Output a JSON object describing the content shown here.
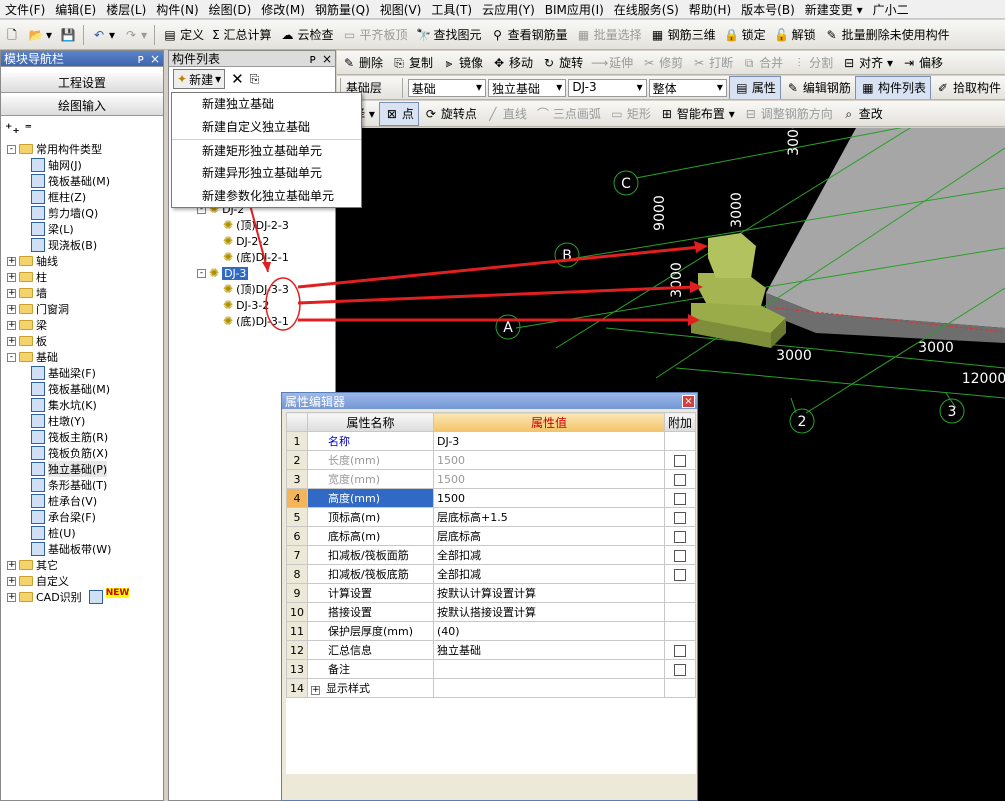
{
  "menu": [
    "文件(F)",
    "编辑(E)",
    "楼层(L)",
    "构件(N)",
    "绘图(D)",
    "修改(M)",
    "钢筋量(Q)",
    "视图(V)",
    "工具(T)",
    "云应用(Y)",
    "BIM应用(I)",
    "在线服务(S)",
    "帮助(H)",
    "版本号(B)",
    "新建变更 ▾",
    "广小二"
  ],
  "toolbar1": [
    "定义",
    "Σ 汇总计算",
    "云检查",
    "平齐板顶",
    "查找图元",
    "查看钢筋量",
    "批量选择",
    "钢筋三维",
    "锁定",
    "解锁",
    "批量删除未使用构件"
  ],
  "toolbar2": [
    "删除",
    "复制",
    "镜像",
    "移动",
    "旋转",
    "延伸",
    "修剪",
    "打断",
    "合并",
    "分割",
    "对齐 ▾",
    "偏移"
  ],
  "toolbar3": {
    "floor_label": "基础层",
    "floor": "基础",
    "type": "独立基础",
    "component": "DJ-3",
    "unit": "整体",
    "buttons": [
      "属性",
      "编辑钢筋",
      "构件列表",
      "拾取构件"
    ]
  },
  "toolbar4": [
    "选择 ▾",
    "点",
    "旋转点",
    "直线",
    "三点画弧",
    "矩形",
    "智能布置 ▾",
    "调整钢筋方向",
    "查改"
  ],
  "nav": {
    "title": "模块导航栏",
    "pin": "ᴘ",
    "close": "×",
    "btn1": "工程设置",
    "btn2": "绘图输入",
    "tree": [
      {
        "t": "常用构件类型",
        "lvl": 0,
        "pm": "-",
        "kind": "folder"
      },
      {
        "t": "轴网(J)",
        "lvl": 1,
        "kind": "comp"
      },
      {
        "t": "筏板基础(M)",
        "lvl": 1,
        "kind": "comp"
      },
      {
        "t": "框柱(Z)",
        "lvl": 1,
        "kind": "comp"
      },
      {
        "t": "剪力墙(Q)",
        "lvl": 1,
        "kind": "comp"
      },
      {
        "t": "梁(L)",
        "lvl": 1,
        "kind": "comp"
      },
      {
        "t": "现浇板(B)",
        "lvl": 1,
        "kind": "comp"
      },
      {
        "t": "轴线",
        "lvl": 0,
        "pm": "+",
        "kind": "folder"
      },
      {
        "t": "柱",
        "lvl": 0,
        "pm": "+",
        "kind": "folder"
      },
      {
        "t": "墙",
        "lvl": 0,
        "pm": "+",
        "kind": "folder"
      },
      {
        "t": "门窗洞",
        "lvl": 0,
        "pm": "+",
        "kind": "folder"
      },
      {
        "t": "梁",
        "lvl": 0,
        "pm": "+",
        "kind": "folder"
      },
      {
        "t": "板",
        "lvl": 0,
        "pm": "+",
        "kind": "folder"
      },
      {
        "t": "基础",
        "lvl": 0,
        "pm": "-",
        "kind": "folder"
      },
      {
        "t": "基础梁(F)",
        "lvl": 1,
        "kind": "comp"
      },
      {
        "t": "筏板基础(M)",
        "lvl": 1,
        "kind": "comp"
      },
      {
        "t": "集水坑(K)",
        "lvl": 1,
        "kind": "comp"
      },
      {
        "t": "柱墩(Y)",
        "lvl": 1,
        "kind": "comp"
      },
      {
        "t": "筏板主筋(R)",
        "lvl": 1,
        "kind": "comp"
      },
      {
        "t": "筏板负筋(X)",
        "lvl": 1,
        "kind": "comp"
      },
      {
        "t": "独立基础(P)",
        "lvl": 1,
        "kind": "comp"
      },
      {
        "t": "条形基础(T)",
        "lvl": 1,
        "kind": "comp"
      },
      {
        "t": "桩承台(V)",
        "lvl": 1,
        "kind": "comp"
      },
      {
        "t": "承台梁(F)",
        "lvl": 1,
        "kind": "comp"
      },
      {
        "t": "桩(U)",
        "lvl": 1,
        "kind": "comp"
      },
      {
        "t": "基础板带(W)",
        "lvl": 1,
        "kind": "comp"
      },
      {
        "t": "其它",
        "lvl": 0,
        "pm": "+",
        "kind": "folder"
      },
      {
        "t": "自定义",
        "lvl": 0,
        "pm": "+",
        "kind": "folder"
      },
      {
        "t": "CAD识别",
        "lvl": 0,
        "pm": "+",
        "kind": "folder",
        "badge": "NEW"
      }
    ]
  },
  "complist": {
    "title": "构件列表",
    "new": "新建",
    "tree": [
      {
        "t": "DJ-2",
        "lvl": 0,
        "pm": "-"
      },
      {
        "t": "(顶)DJ-2-3",
        "lvl": 1
      },
      {
        "t": "DJ-2-2",
        "lvl": 1
      },
      {
        "t": "(底)DJ-2-1",
        "lvl": 1
      },
      {
        "t": "DJ-3",
        "lvl": 0,
        "pm": "-",
        "sel": true
      },
      {
        "t": "(顶)DJ-3-3",
        "lvl": 1
      },
      {
        "t": "DJ-3-2",
        "lvl": 1
      },
      {
        "t": "(底)DJ-3-1",
        "lvl": 1
      }
    ]
  },
  "dropdown": [
    "新建独立基础",
    "新建自定义独立基础",
    "新建矩形独立基础单元",
    "新建异形独立基础单元",
    "新建参数化独立基础单元"
  ],
  "view3d": {
    "labels": [
      "C",
      "B",
      "A",
      "2",
      "3"
    ],
    "dims": [
      "9000",
      "3000",
      "3000",
      "3000",
      "3000",
      "3000",
      "12000",
      "3000"
    ]
  },
  "props": {
    "title": "属性编辑器",
    "headers": [
      "属性名称",
      "属性值",
      "附加"
    ],
    "rows": [
      {
        "n": "名称",
        "v": "DJ-3",
        "c": false,
        "style": "blue"
      },
      {
        "n": "长度(mm)",
        "v": "1500",
        "c": true,
        "style": "gray"
      },
      {
        "n": "宽度(mm)",
        "v": "1500",
        "c": true,
        "style": "gray"
      },
      {
        "n": "高度(mm)",
        "v": "1500",
        "c": true,
        "style": "sel"
      },
      {
        "n": "顶标高(m)",
        "v": "层底标高+1.5",
        "c": true
      },
      {
        "n": "底标高(m)",
        "v": "层底标高",
        "c": true
      },
      {
        "n": "扣减板/筏板面筋",
        "v": "全部扣减",
        "c": true
      },
      {
        "n": "扣减板/筏板底筋",
        "v": "全部扣减",
        "c": true
      },
      {
        "n": "计算设置",
        "v": "按默认计算设置计算",
        "c": false
      },
      {
        "n": "搭接设置",
        "v": "按默认搭接设置计算",
        "c": false
      },
      {
        "n": "保护层厚度(mm)",
        "v": "(40)",
        "c": false
      },
      {
        "n": "汇总信息",
        "v": "独立基础",
        "c": true
      },
      {
        "n": "备注",
        "v": "",
        "c": true
      },
      {
        "n": "显示样式",
        "v": "",
        "c": false,
        "expand": true
      }
    ]
  },
  "colors": {
    "accent": "#316ac5",
    "annotation": "#e02020",
    "footing": "#9aab4a",
    "slab": "#a8a8a8",
    "grid": "#2aa02a"
  }
}
